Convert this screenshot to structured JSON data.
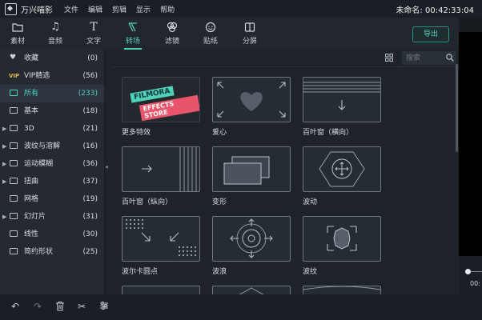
{
  "titlebar": {
    "app_name": "万兴喵影",
    "menu": [
      "文件",
      "编辑",
      "剪辑",
      "显示",
      "帮助"
    ],
    "project_label": "未命名: 00:42:33:04"
  },
  "toolbar": {
    "items": [
      {
        "label": "素材",
        "icon": "folder-icon"
      },
      {
        "label": "音频",
        "icon": "music-note-icon"
      },
      {
        "label": "文字",
        "icon": "text-icon"
      },
      {
        "label": "转场",
        "icon": "transition-icon"
      },
      {
        "label": "滤镜",
        "icon": "filter-icon"
      },
      {
        "label": "贴纸",
        "icon": "sticker-icon"
      },
      {
        "label": "分屏",
        "icon": "split-screen-icon"
      }
    ],
    "active_index": 3,
    "export_label": "导出"
  },
  "sidebar": {
    "items": [
      {
        "label": "收藏",
        "count": "(0)"
      },
      {
        "label": "VIP精选",
        "count": "(56)",
        "badge": "VIP"
      },
      {
        "label": "所有",
        "count": "(233)"
      },
      {
        "label": "基本",
        "count": "(18)"
      },
      {
        "label": "3D",
        "count": "(21)"
      },
      {
        "label": "波纹与溶解",
        "count": "(16)"
      },
      {
        "label": "运动模糊",
        "count": "(36)"
      },
      {
        "label": "扭曲",
        "count": "(37)"
      },
      {
        "label": "网格",
        "count": "(19)"
      },
      {
        "label": "幻灯片",
        "count": "(31)"
      },
      {
        "label": "线性",
        "count": "(30)"
      },
      {
        "label": "简约形状",
        "count": "(25)"
      }
    ],
    "active_index": 2
  },
  "search": {
    "placeholder": "搜索"
  },
  "tiles": {
    "items": [
      {
        "label": "更多特效",
        "thumb_text_1": "FILMORA",
        "thumb_text_2": "EFFECTS STORE"
      },
      {
        "label": "爱心"
      },
      {
        "label": "百叶窗（横向）"
      },
      {
        "label": "百叶窗（纵向）"
      },
      {
        "label": "变形"
      },
      {
        "label": "波动"
      },
      {
        "label": "波尔卡圆点"
      },
      {
        "label": "波浪"
      },
      {
        "label": "波纹"
      }
    ]
  },
  "preview": {
    "time": "00:"
  },
  "colors": {
    "accent": "#4fd1b8",
    "background": "#1e232a",
    "vip": "#e5b857"
  }
}
